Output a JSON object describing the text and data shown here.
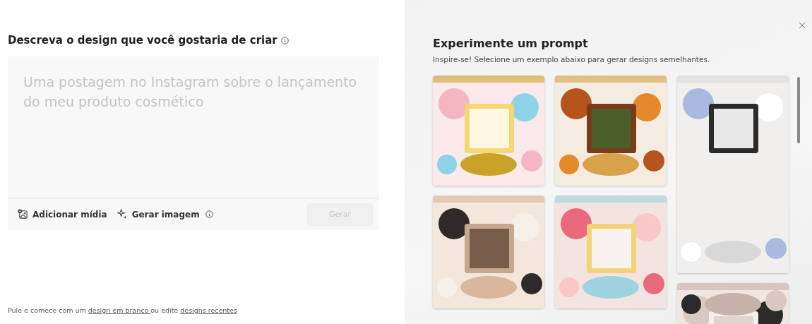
{
  "composer": {
    "title": "Descreva o design que você gostaria de criar",
    "prompt": {
      "placeholder": "Uma postagem no Instagram sobre o lançamento do meu produto cosmético"
    },
    "actions": [
      {
        "kind": "media",
        "label": "Adicionar mídia",
        "info": false
      },
      {
        "kind": "generate-image",
        "label": "Gerar imagem",
        "info": true
      }
    ],
    "submit": {
      "label": "Gerar",
      "disabled": true
    }
  },
  "footer": {
    "before": "Pule e comece com um ",
    "link_1": "design em branco ",
    "middle": "ou edite ",
    "link_2": "designs recentes"
  },
  "examples": {
    "title": "Experimente um prompt",
    "subtitle": "Inspire-se! Selecione um exemplo abaixo para gerar designs semelhantes."
  }
}
